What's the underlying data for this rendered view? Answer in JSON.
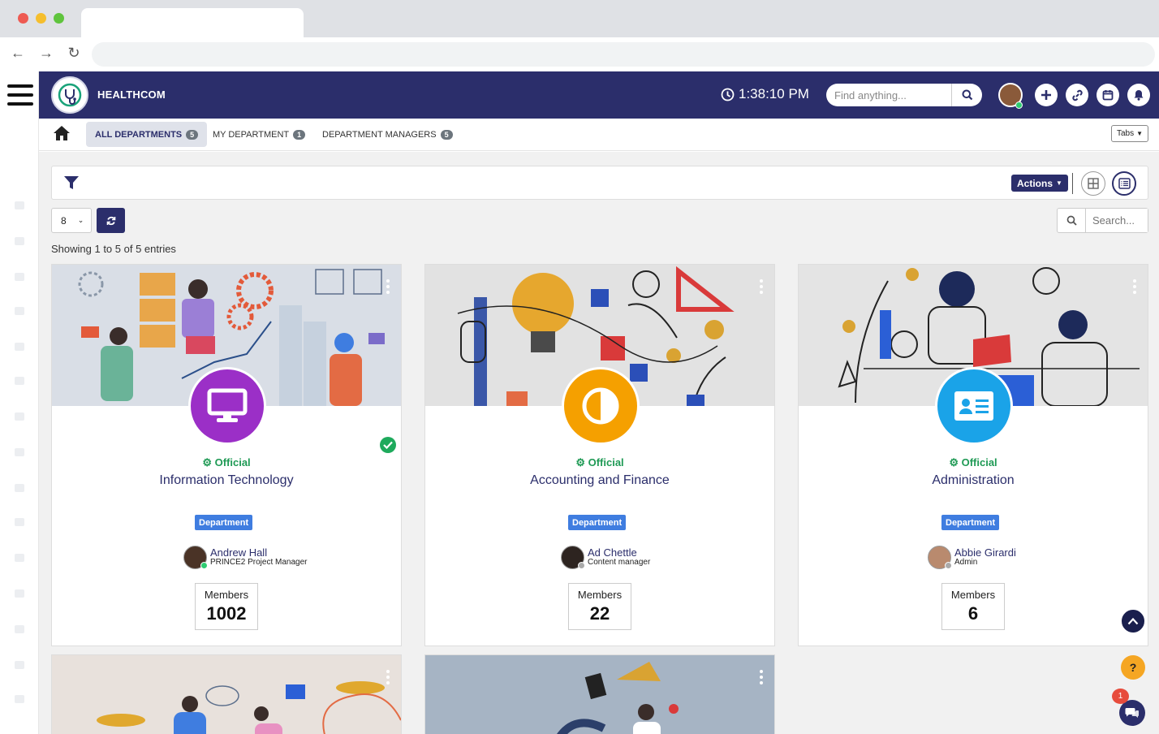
{
  "header": {
    "brand": "HEALTHCOM",
    "time": "1:38:10 PM",
    "search_placeholder": "Find anything..."
  },
  "tabs": [
    {
      "label": "ALL DEPARTMENTS",
      "count": "5"
    },
    {
      "label": "MY DEPARTMENT",
      "count": "1"
    },
    {
      "label": "DEPARTMENT MANAGERS",
      "count": "5"
    }
  ],
  "tabs_dropdown": "Tabs",
  "toolbar": {
    "actions_label": "Actions",
    "page_size": "8",
    "search_placeholder": "Search...",
    "showing": "Showing 1 to 5 of 5 entries"
  },
  "cards": [
    {
      "status": "Official",
      "name": "Information Technology",
      "type": "Department",
      "manager": "Andrew Hall",
      "role": "PRINCE2 Project Manager",
      "members_label": "Members",
      "members": "1002"
    },
    {
      "status": "Official",
      "name": "Accounting and Finance",
      "type": "Department",
      "manager": "Ad Chettle",
      "role": "Content manager",
      "members_label": "Members",
      "members": "22"
    },
    {
      "status": "Official",
      "name": "Administration",
      "type": "Department",
      "manager": "Abbie Girardi",
      "role": "Admin",
      "members_label": "Members",
      "members": "6"
    }
  ],
  "chat_badge": "1",
  "help_label": "?",
  "colors": {
    "brand": "#2b2e6b",
    "official": "#1f9a55",
    "it_icon": "#9b2fc7",
    "finance_icon": "#f5a000",
    "admin_icon": "#1aa3e8"
  }
}
